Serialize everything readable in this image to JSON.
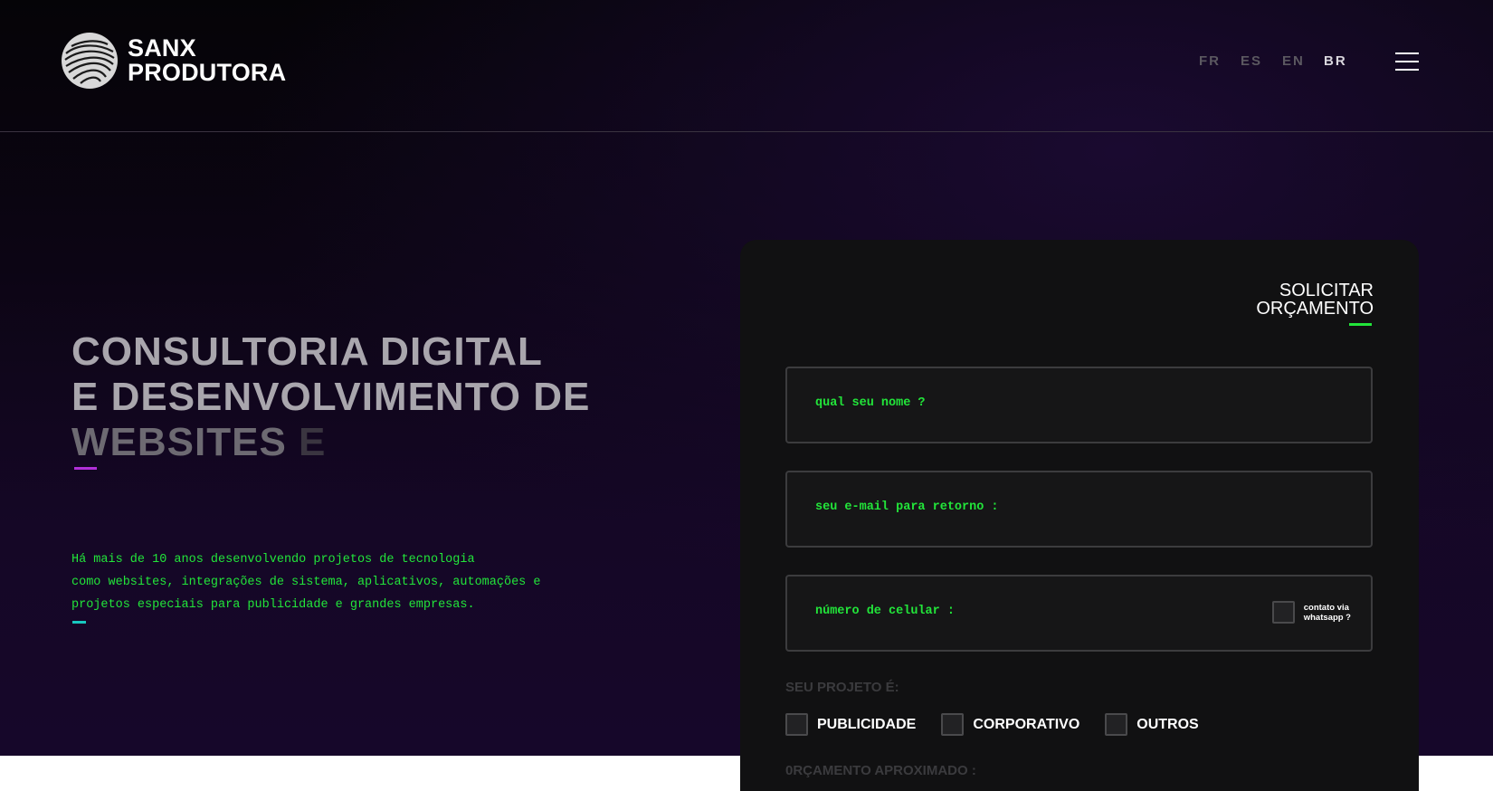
{
  "header": {
    "brand_line1": "SANX",
    "brand_line2": "PRODUTORA",
    "languages": [
      "FR",
      "ES",
      "EN",
      "BR"
    ],
    "active_language": "BR"
  },
  "hero": {
    "headline_line1": "CONSULTORIA DIGITAL",
    "headline_line2": "E DESENVOLVIMENTO DE",
    "headline_line3a": "WEBSITES",
    "headline_line3b": "E",
    "intro_line1": "Há mais de 10 anos desenvolvendo projetos de tecnologia",
    "intro_line2": "como websites, integrações de sistema, aplicativos, automações e",
    "intro_line3": "projetos especiais para publicidade e grandes empresas."
  },
  "form": {
    "title_line1": "SOLICITAR",
    "title_line2": "ORÇAMENTO",
    "name_placeholder": "qual seu nome ?",
    "email_placeholder": "seu e-mail para retorno :",
    "phone_placeholder": "número de celular :",
    "whatsapp_line1": "contato via",
    "whatsapp_line2": "whatsapp ?",
    "project_label": "SEU PROJETO É:",
    "project_options": [
      "PUBLICIDADE",
      "CORPORATIVO",
      "OUTROS"
    ],
    "budget_label": "0RÇAMENTO APROXIMADO :"
  },
  "colors": {
    "accent_green": "#22e53a",
    "accent_purple": "#b130d8",
    "accent_cyan": "#18c8c0"
  }
}
